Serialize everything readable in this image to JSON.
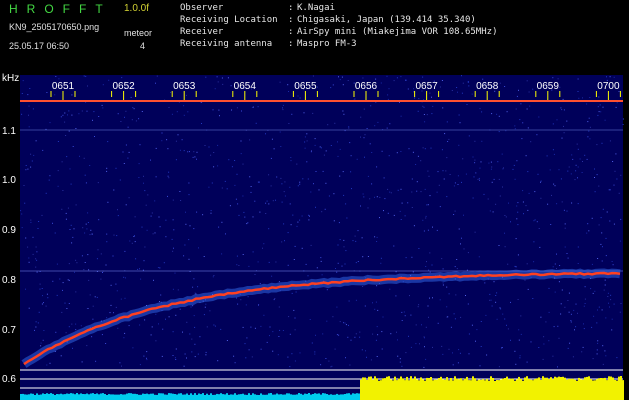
{
  "header": {
    "app_title": "HROFFT",
    "version": "1.0.0f",
    "file_name": "KN9_2505170650.png",
    "date_time": "25.05.17 06:50",
    "mode_label": "meteor",
    "mode_value": "4"
  },
  "info": [
    {
      "key": "Observer",
      "value": "K.Nagai"
    },
    {
      "key": "Receiving Location",
      "value": "Chigasaki, Japan (139.414 35.340)"
    },
    {
      "key": "Receiver",
      "value": "AirSpy mini (Miakejima VOR 108.65MHz)"
    },
    {
      "key": "Receiving antenna",
      "value": "Maspro FM-3"
    }
  ],
  "info_separator": ":",
  "spectrogram": {
    "y_unit": "kHz",
    "y_ticks": [
      "1.1",
      "1.0",
      "0.9",
      "0.8",
      "0.7",
      "0.6"
    ],
    "time_ticks": [
      "0651",
      "0652",
      "0653",
      "0654",
      "0655",
      "0656",
      "0657",
      "0658",
      "0659",
      "0700"
    ],
    "colors": {
      "background": "#00005a",
      "carrier": "#ff5030",
      "signal_trace": "#ff4020",
      "level_low": "#00ccee",
      "level_high": "#f2f200",
      "tick": "#ffff00"
    }
  }
}
